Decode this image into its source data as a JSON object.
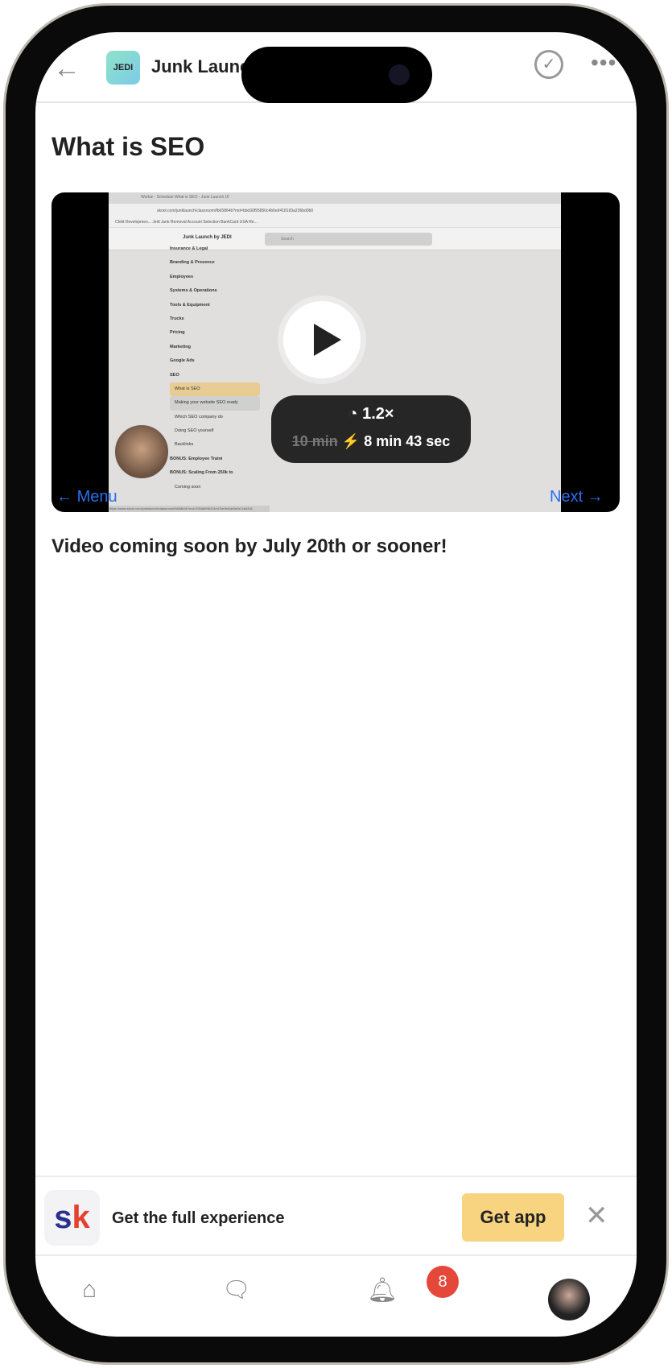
{
  "header": {
    "back_icon": "arrow-left-icon",
    "app_title": "Junk Launch by JEDI",
    "logo_text": "JEDI",
    "complete_icon": "check-circle-icon",
    "more_icon": "ellipsis-icon"
  },
  "page_title": "What is SEO",
  "video": {
    "browser_tabs": "Workiz - Schedule    What is SEO - Junk Launch UI",
    "url": "skool.com/junklaunch/classroom/fb65864b?md=bbd30f95850c4b6e9418183a236bd0b0",
    "bookmarks": "Child Developmen...   Jedi Junk Removal   Account Selection   BankCard USA Re...",
    "community": "Junk Launch by JEDI",
    "search_placeholder": "Search",
    "menu": [
      {
        "label": "Insurance & Legal"
      },
      {
        "label": "Branding & Presence"
      },
      {
        "label": "Employees"
      },
      {
        "label": "Systems & Operations"
      },
      {
        "label": "Tools & Equipment"
      },
      {
        "label": "Trucks"
      },
      {
        "label": "Pricing"
      },
      {
        "label": "Marketing"
      },
      {
        "label": "Google Ads"
      },
      {
        "label": "SEO"
      },
      {
        "label": "What is SEO"
      },
      {
        "label": "Making your website SEO ready"
      },
      {
        "label": "Which SEO company do"
      },
      {
        "label": "Doing SEO yourself"
      },
      {
        "label": "Backlinks"
      },
      {
        "label": "BONUS: Employee Traini"
      },
      {
        "label": "BONUS: Scaling From 250k to"
      },
      {
        "label": "Coming soon"
      }
    ],
    "status_url": "https://www.skool.com/junklaunch/classroom/fb65864b?md=295d8996414e47be9e0de5a3e7c6d341",
    "speed": "1.2×",
    "original_duration": "10 min",
    "new_duration": "8 min 43 sec",
    "speed_icon": "gauge-icon",
    "bolt_icon": "lightning-icon"
  },
  "nav": {
    "menu_label": "Menu",
    "next_label": "Next"
  },
  "notice": "Video coming soon by July 20th or sooner!",
  "banner": {
    "logo": "sk",
    "text": "Get the full experience",
    "button": "Get app"
  },
  "tabbar": {
    "badge": "8"
  },
  "colors": {
    "link": "#2a6ff0",
    "cta": "#f8d480",
    "badge": "#e5483a"
  }
}
